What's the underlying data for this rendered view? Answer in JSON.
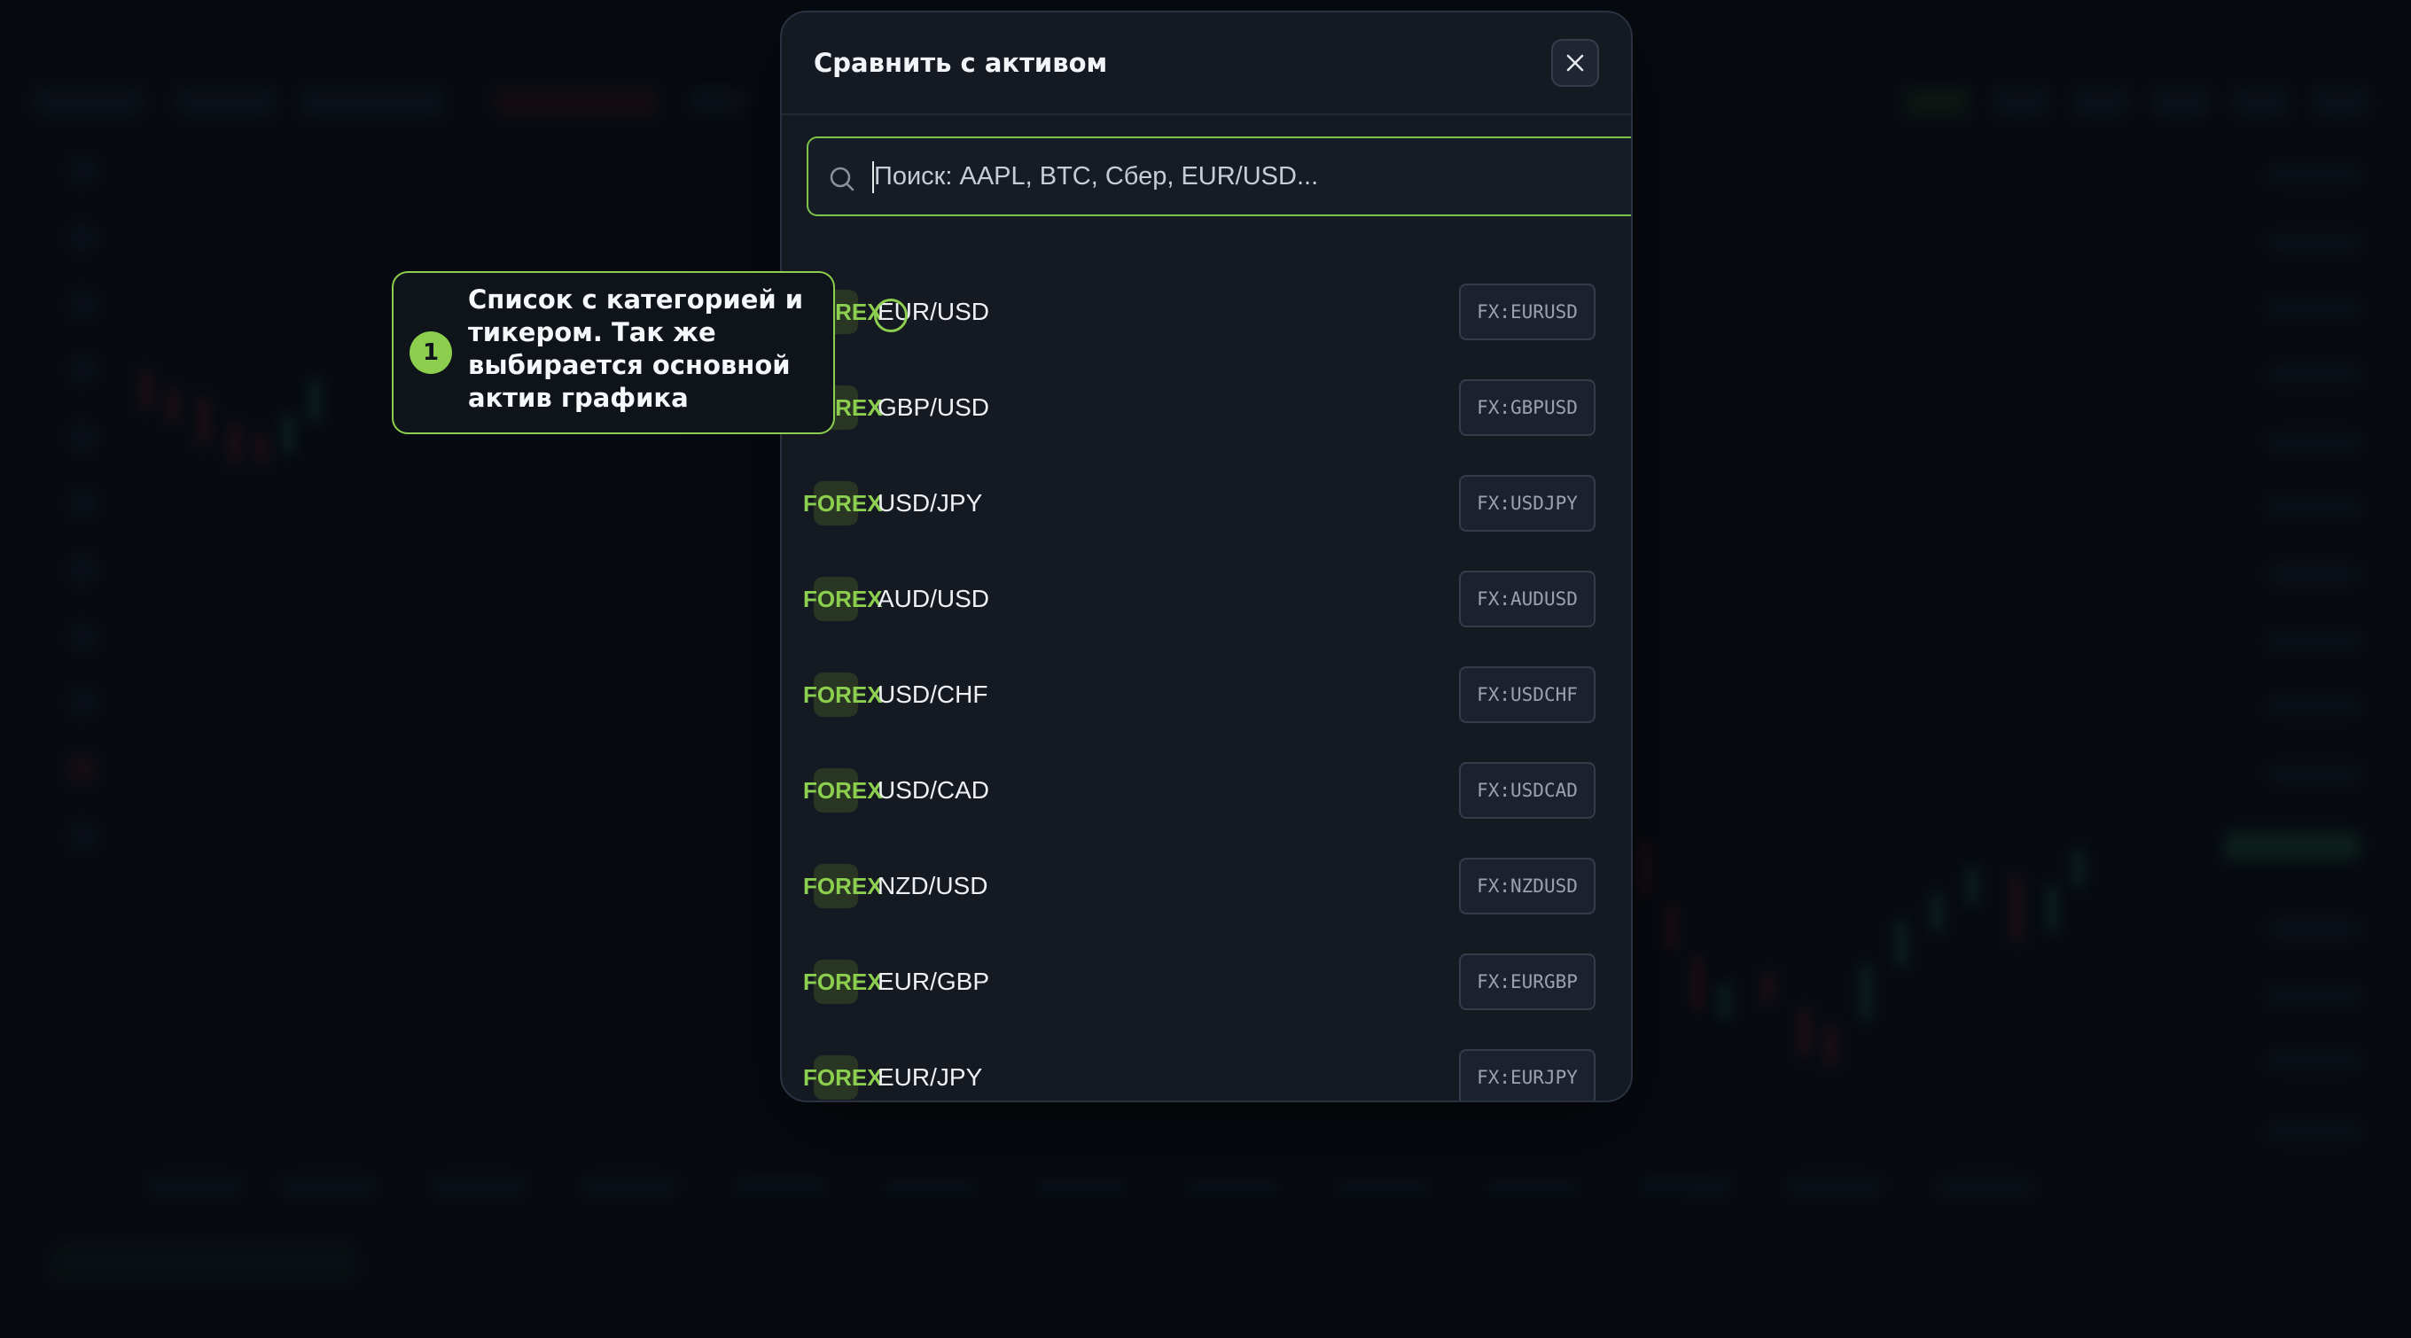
{
  "modal": {
    "title": "Сравнить с активом",
    "close_icon": "close-icon",
    "search": {
      "icon": "search-icon",
      "placeholder": "Поиск: AAPL, BTC, Сбер, EUR/USD..."
    },
    "items": [
      {
        "category": "FOREX",
        "name": "EUR/USD",
        "ticker": "FX:EURUSD"
      },
      {
        "category": "FOREX",
        "name": "GBP/USD",
        "ticker": "FX:GBPUSD"
      },
      {
        "category": "FOREX",
        "name": "USD/JPY",
        "ticker": "FX:USDJPY"
      },
      {
        "category": "FOREX",
        "name": "AUD/USD",
        "ticker": "FX:AUDUSD"
      },
      {
        "category": "FOREX",
        "name": "USD/CHF",
        "ticker": "FX:USDCHF"
      },
      {
        "category": "FOREX",
        "name": "USD/CAD",
        "ticker": "FX:USDCAD"
      },
      {
        "category": "FOREX",
        "name": "NZD/USD",
        "ticker": "FX:NZDUSD"
      },
      {
        "category": "FOREX",
        "name": "EUR/GBP",
        "ticker": "FX:EURGBP"
      },
      {
        "category": "FOREX",
        "name": "EUR/JPY",
        "ticker": "FX:EURJPY"
      }
    ]
  },
  "callout": {
    "number": "1",
    "text": "Список с категорией и\nтикером. Так же\nвыбирается основной\nактив графика"
  },
  "colors": {
    "accent": "#8ccf4f",
    "background": "#0b0f16",
    "modal_bg": "#141922"
  }
}
